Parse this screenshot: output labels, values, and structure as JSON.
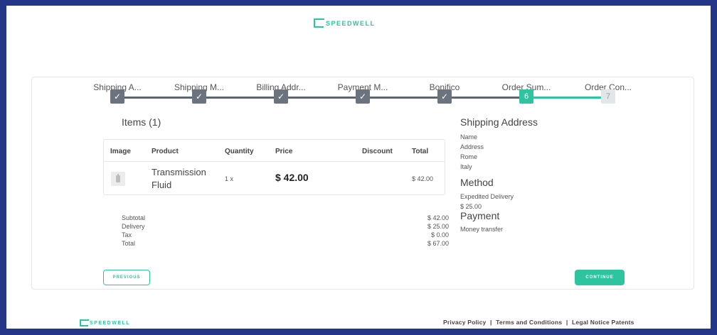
{
  "brand": {
    "name": "SPEEDWELL",
    "color": "#2ec4a0"
  },
  "stepper": {
    "steps": [
      {
        "label": "Shipping A...",
        "state": "done"
      },
      {
        "label": "Shipping M...",
        "state": "done"
      },
      {
        "label": "Billing Addr...",
        "state": "done"
      },
      {
        "label": "Payment M...",
        "state": "done"
      },
      {
        "label": "Bonifico",
        "state": "done"
      },
      {
        "label": "Order Sum...",
        "state": "active",
        "number": "6"
      },
      {
        "label": "Order Con...",
        "state": "pending",
        "number": "7"
      }
    ]
  },
  "items": {
    "title": "Items (1)",
    "columns": [
      "Image",
      "Product",
      "Quantity",
      "Price",
      "Discount",
      "Total"
    ],
    "rows": [
      {
        "product": "Transmission Fluid",
        "quantity": "1 x",
        "price": "$ 42.00",
        "discount": "",
        "total": "$ 42.00"
      }
    ]
  },
  "summary": [
    {
      "label": "Subtotal",
      "value": "$ 42.00"
    },
    {
      "label": "Delivery",
      "value": "$ 25.00"
    },
    {
      "label": "Tax",
      "value": "$ 0.00"
    },
    {
      "label": "Total",
      "value": "$ 67.00"
    }
  ],
  "buttons": {
    "previous": "PREVIOUS",
    "continue": "CONTINUE"
  },
  "shipping_address": {
    "title": "Shipping Address",
    "lines": [
      "Name",
      "Address",
      "Rome",
      "Italy"
    ]
  },
  "method": {
    "title": "Method",
    "name": "Expedited Delivery",
    "price": "$ 25.00"
  },
  "payment": {
    "title": "Payment",
    "name": "Money transfer"
  },
  "footer": {
    "links": [
      "Privacy Policy",
      "Terms and Conditions",
      "Legal Notice Patents"
    ],
    "separator": "|"
  },
  "colors": {
    "frame": "#253689",
    "accent": "#2ec4a0",
    "step_done": "#6b737e"
  },
  "icons": {
    "check": "check-icon",
    "product_thumb": "bottle-icon"
  }
}
